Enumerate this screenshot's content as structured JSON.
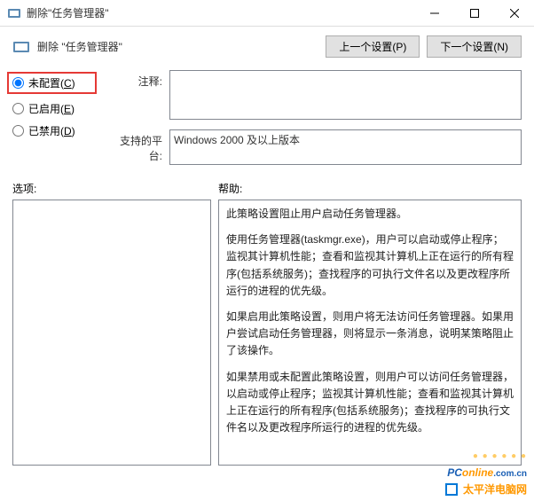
{
  "titlebar": {
    "title": "删除\"任务管理器\""
  },
  "header": {
    "label": "删除 \"任务管理器\"",
    "prev": "上一个设置(P)",
    "next": "下一个设置(N)"
  },
  "radios": {
    "not_configured": "未配置(C)",
    "enabled": "已启用(E)",
    "disabled": "已禁用(D)"
  },
  "fields": {
    "comment_label": "注释:",
    "comment_value": "",
    "platform_label": "支持的平台:",
    "platform_value": "Windows 2000 及以上版本"
  },
  "sections": {
    "options": "选项:",
    "help": "帮助:"
  },
  "help_paragraphs": [
    "此策略设置阻止用户启动任务管理器。",
    "使用任务管理器(taskmgr.exe)，用户可以启动或停止程序；监视其计算机性能；查看和监视其计算机上正在运行的所有程序(包括系统服务)；查找程序的可执行文件名以及更改程序所运行的进程的优先级。",
    "如果启用此策略设置，则用户将无法访问任务管理器。如果用户尝试启动任务管理器，则将显示一条消息，说明某策略阻止了该操作。",
    "如果禁用或未配置此策略设置，则用户可以访问任务管理器，以启动或停止程序；监视其计算机性能；查看和监视其计算机上正在运行的所有程序(包括系统服务)；查找程序的可执行文件名以及更改程序所运行的进程的优先级。"
  ],
  "watermark": {
    "brand_pc": "PC",
    "brand_on": "online",
    "brand_suffix": ".com.cn",
    "cn": "太平洋电脑网"
  }
}
